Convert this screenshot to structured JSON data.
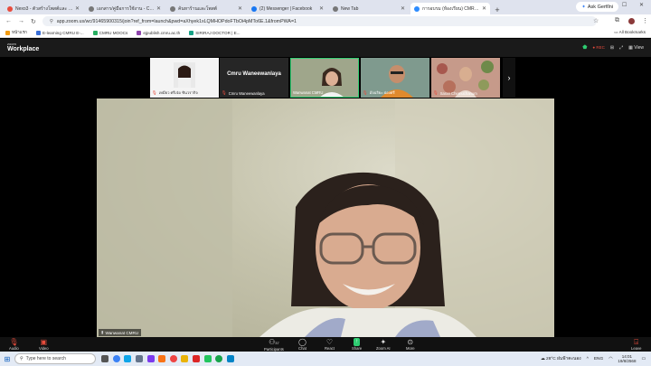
{
  "browser": {
    "tabs": [
      {
        "label": "Nexo3 - ตัวสร้างโพสต์และ เขียนบล็อก...",
        "color": "#e84c3d"
      },
      {
        "label": "เอกสาร/คู่มือการใช้งาน - Chrome...",
        "color": "#777777"
      },
      {
        "label": "ค้นหาร้านและโพสต์",
        "color": "#777777"
      },
      {
        "label": "(2) Messenger | Facebook",
        "color": "#1877f2"
      },
      {
        "label": "New Tab",
        "color": "#777777"
      },
      {
        "label": "การอบรม (ห้องเรียน) CMRU ...",
        "color": "#2d8cff"
      }
    ],
    "ask_gemini": "Ask Gemini",
    "url": "app.zoom.us/wc/91465900315/join?ref_from=launch&pwd=aXhyek1xLQMHOPdoFTbOi4pMTo6E.1&fromPWA=1",
    "bookmarks": [
      {
        "label": "หน้าแรก",
        "color": "#f39c12"
      },
      {
        "label": "E-learning CMRU E-...",
        "color": "#3a6fd8"
      },
      {
        "label": "CMRU MOOCs",
        "color": "#27ae60"
      },
      {
        "label": "ejpublish.cmru.ac.th",
        "color": "#8e44ad"
      },
      {
        "label": "SIRIRAJ DOCTOR | E...",
        "color": "#16a085"
      }
    ],
    "all_bookmarks": "All Bookmarks"
  },
  "zoom": {
    "brand_small": "zoom",
    "brand_big": "Workplace",
    "rec": "REC",
    "view": "View",
    "participants": [
      {
        "name": "เหมียว ศรีเจ๋อ ชินวรากิจ"
      },
      {
        "name": "Cmru Waneewanlaya",
        "tile_title": "Cmru Waneewanlaya"
      },
      {
        "name": "Wanwanat CMRU"
      },
      {
        "name": "อัจฉริยะ ผ่องศรี"
      },
      {
        "name": "Saran Chernuchanum"
      }
    ],
    "main_speaker": "Wanwanat CMRU",
    "toolbar": [
      {
        "label": "Audio",
        "icon": "mic-muted-icon",
        "color": "#e74c3c"
      },
      {
        "label": "Video",
        "icon": "video-muted-icon",
        "color": "#e74c3c"
      },
      {
        "label": "Participants",
        "icon": "participants-icon",
        "count": "37",
        "color": "#dddddd"
      },
      {
        "label": "Chat",
        "icon": "chat-icon",
        "color": "#dddddd"
      },
      {
        "label": "React",
        "icon": "heart-icon",
        "color": "#dddddd"
      },
      {
        "label": "Share",
        "icon": "share-icon",
        "color": "#2ecc71"
      },
      {
        "label": "Zoom AI",
        "icon": "sparkle-icon",
        "color": "#dddddd"
      },
      {
        "label": "More",
        "icon": "more-icon",
        "color": "#dddddd"
      },
      {
        "label": "Leave",
        "icon": "leave-icon",
        "color": "#e74c3c"
      }
    ]
  },
  "taskbar": {
    "search_placeholder": "Type here to search",
    "weather": "28°C",
    "weather_desc": "ฝนฟ้าคะนอง",
    "lang": "ENG",
    "time": "14:01",
    "date": "19/8/2568",
    "app_colors": [
      "#555555",
      "#3b82f6",
      "#0ea5e9",
      "#64748b",
      "#7c3aed",
      "#f97316",
      "#22c55e",
      "#eab308",
      "#ef4444",
      "#2563eb",
      "#16a34a",
      "#0284c7"
    ]
  }
}
